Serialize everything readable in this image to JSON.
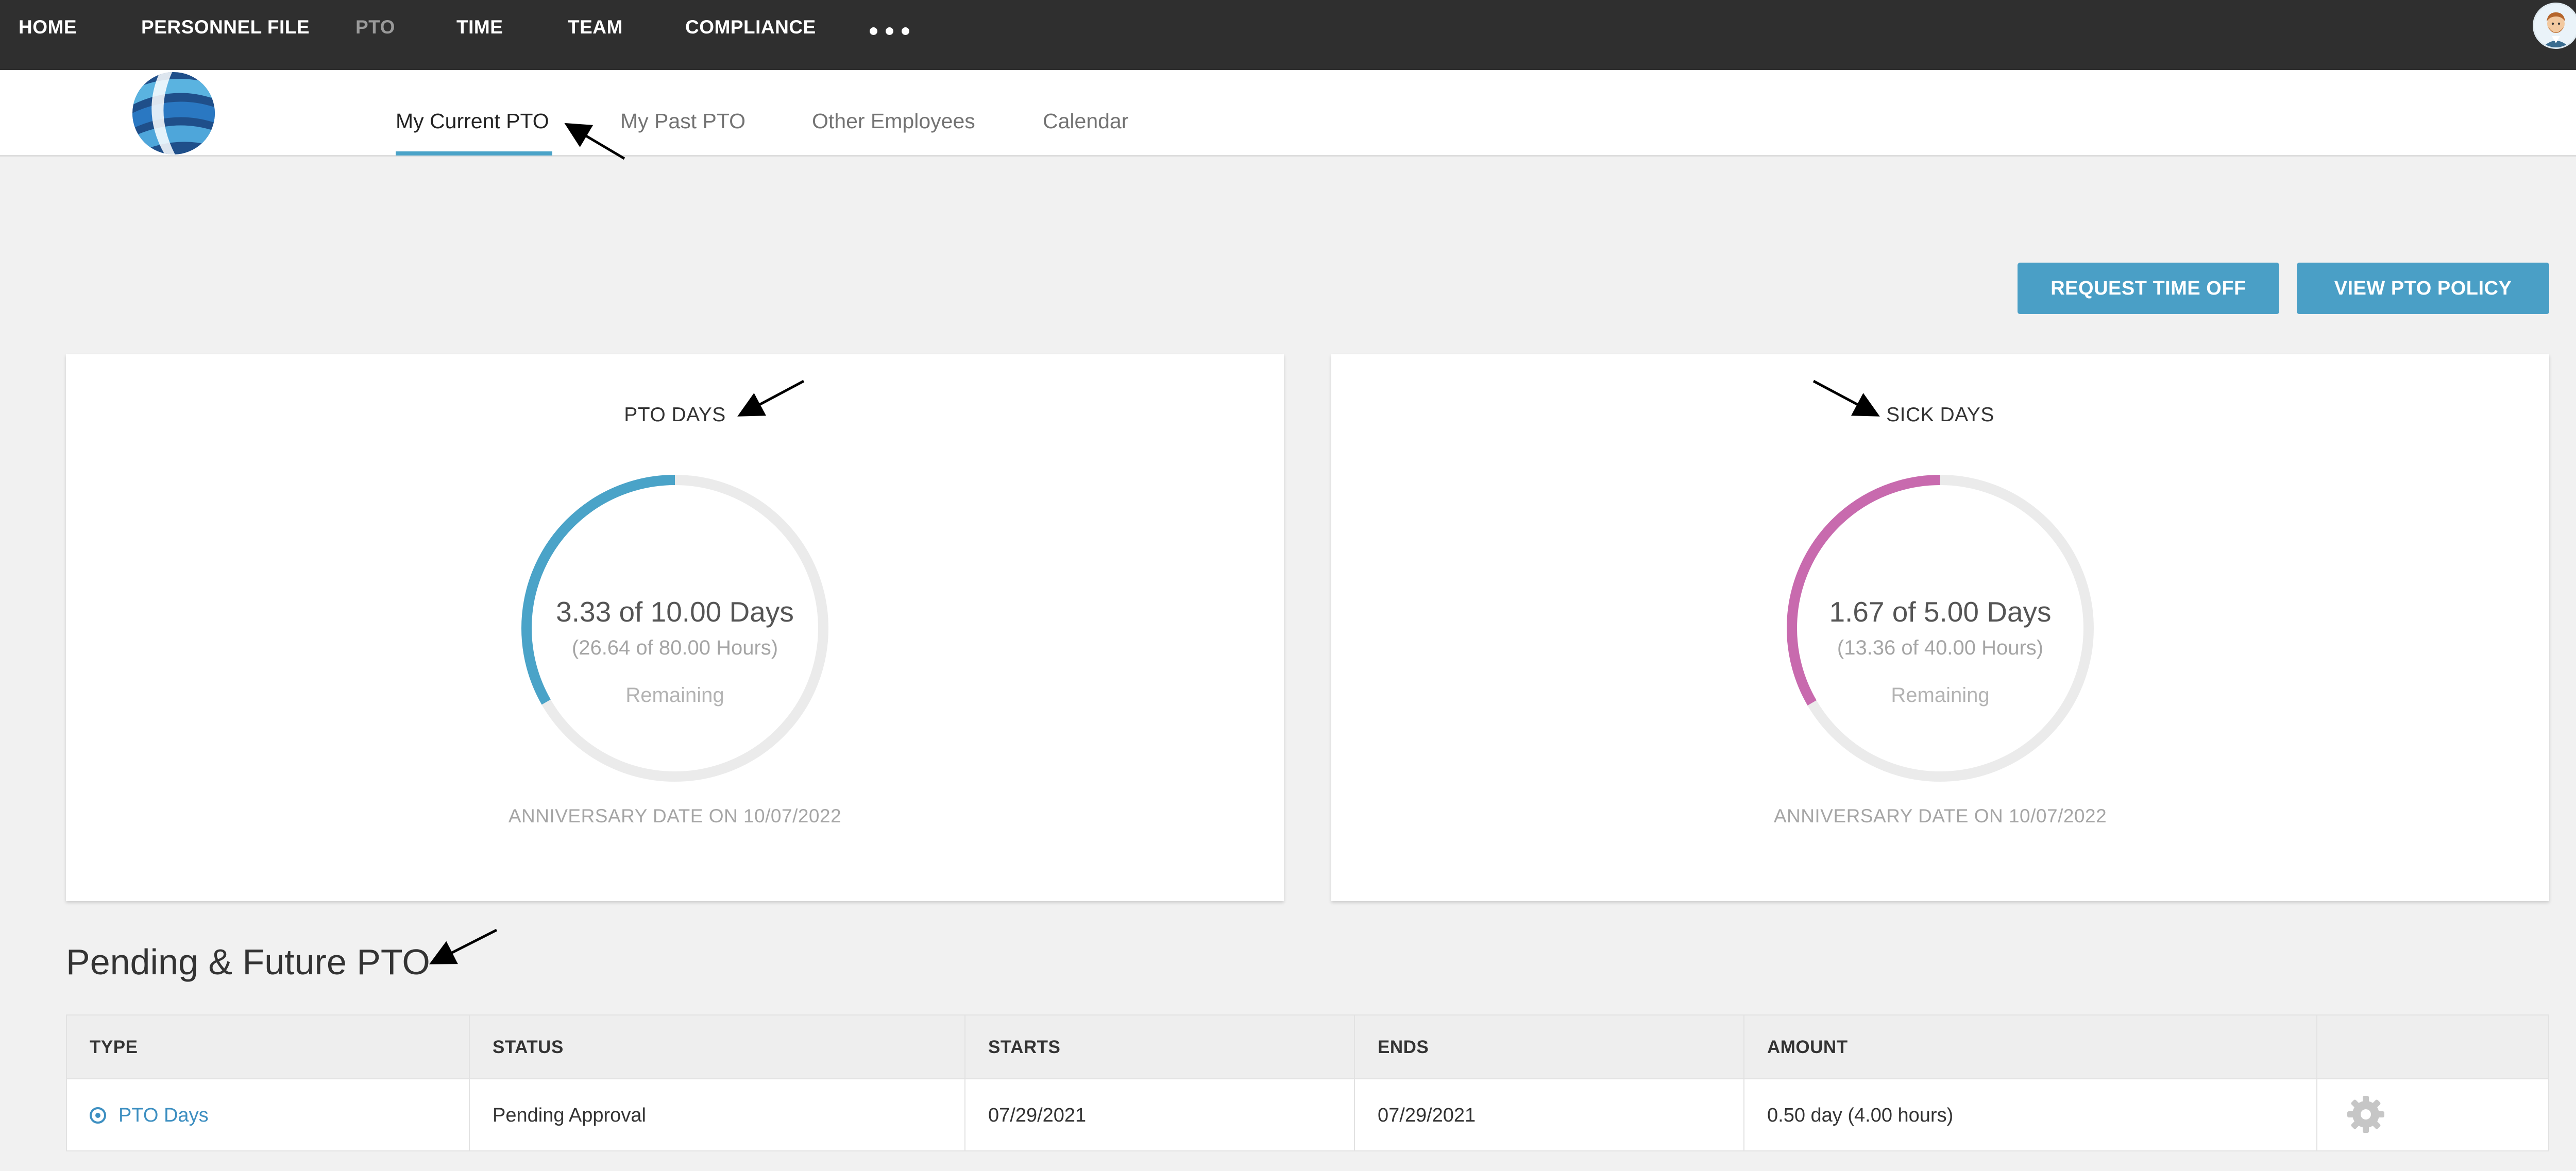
{
  "topnav": {
    "items": [
      {
        "label": "HOME",
        "active": false
      },
      {
        "label": "PERSONNEL FILE",
        "active": false
      },
      {
        "label": "PTO",
        "active": true
      },
      {
        "label": "TIME",
        "active": false
      },
      {
        "label": "TEAM",
        "active": false
      },
      {
        "label": "COMPLIANCE",
        "active": false
      }
    ],
    "more_icon": "more-dots-icon",
    "avatar_icon": "user-avatar-icon"
  },
  "subnav": {
    "tabs": [
      {
        "label": "My Current PTO",
        "active": true
      },
      {
        "label": "My Past PTO",
        "active": false
      },
      {
        "label": "Other Employees",
        "active": false
      },
      {
        "label": "Calendar",
        "active": false
      }
    ]
  },
  "actions": {
    "request_label": "REQUEST TIME OFF",
    "policy_label": "VIEW PTO POLICY"
  },
  "cards": {
    "pto": {
      "title": "PTO DAYS",
      "main": "3.33 of 10.00 Days",
      "sub": "(26.64 of 80.00 Hours)",
      "remaining": "Remaining",
      "anniversary": "ANNIVERSARY DATE ON 10/07/2022",
      "fraction": 0.333,
      "color": "#4aa3c8"
    },
    "sick": {
      "title": "SICK DAYS",
      "main": "1.67 of 5.00 Days",
      "sub": "(13.36 of 40.00 Hours)",
      "remaining": "Remaining",
      "anniversary": "ANNIVERSARY DATE ON 10/07/2022",
      "fraction": 0.334,
      "color": "#c86aae"
    }
  },
  "pending": {
    "title": "Pending & Future PTO",
    "headers": [
      "TYPE",
      "STATUS",
      "STARTS",
      "ENDS",
      "AMOUNT"
    ],
    "rows": [
      {
        "type": "PTO Days",
        "status": "Pending Approval",
        "starts": "07/29/2021",
        "ends": "07/29/2021",
        "amount": "0.50 day (4.00 hours)",
        "icon": "gear-icon"
      }
    ]
  },
  "colors": {
    "topbar": "#2f2f2f",
    "accent": "#4a9fc6",
    "pto_ring": "#4aa3c8",
    "sick_ring": "#c86aae",
    "ring_track": "#ebebeb"
  }
}
